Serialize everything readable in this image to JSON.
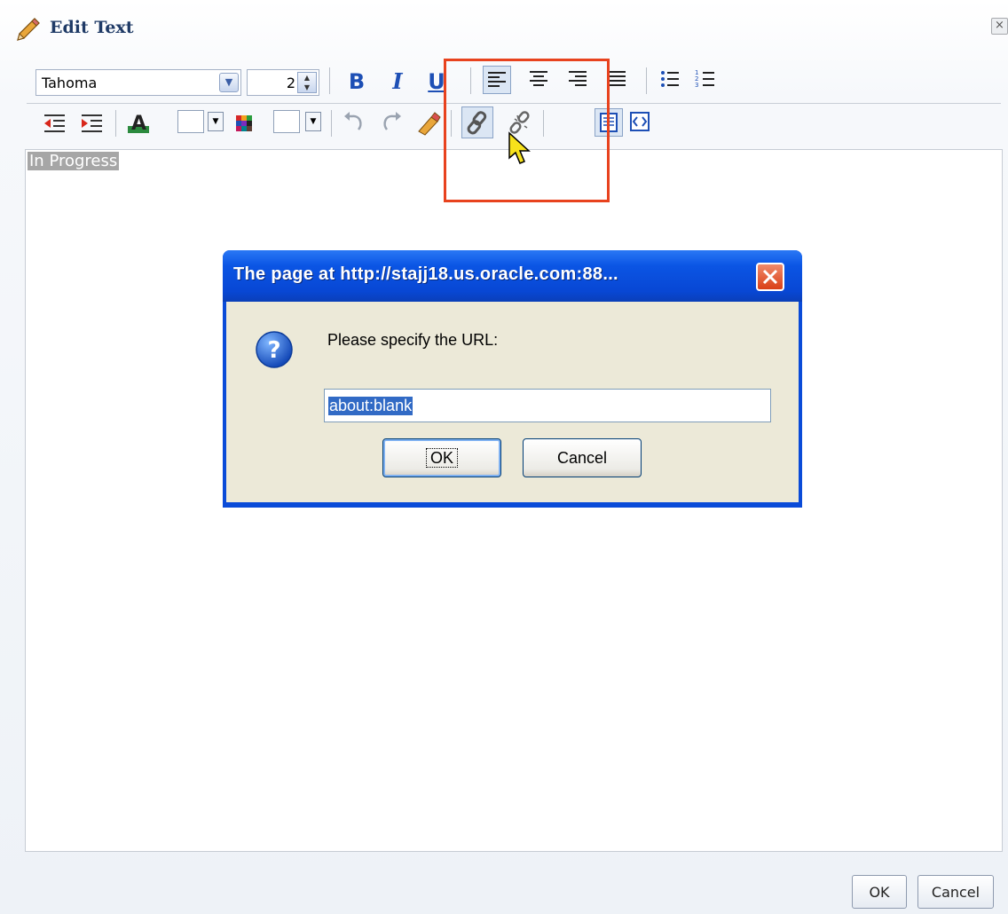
{
  "window": {
    "title": "Edit Text",
    "close_glyph": "×"
  },
  "toolbar": {
    "font_name": "Tahoma",
    "font_size": "2",
    "bold_label": "B",
    "italic_label": "I",
    "underline_label": "U"
  },
  "editor": {
    "content": "In Progress"
  },
  "footer": {
    "ok_label": "OK",
    "cancel_label": "Cancel"
  },
  "prompt": {
    "title": "The page at http://stajj18.us.oracle.com:88...",
    "message": "Please specify the URL:",
    "input_value": "about:blank",
    "ok_label": "OK",
    "cancel_label": "Cancel"
  },
  "colors": {
    "highlight_box": "#e8421e",
    "xp_title_blue": "#0b55e4",
    "dialog_body": "#ece9d8"
  }
}
